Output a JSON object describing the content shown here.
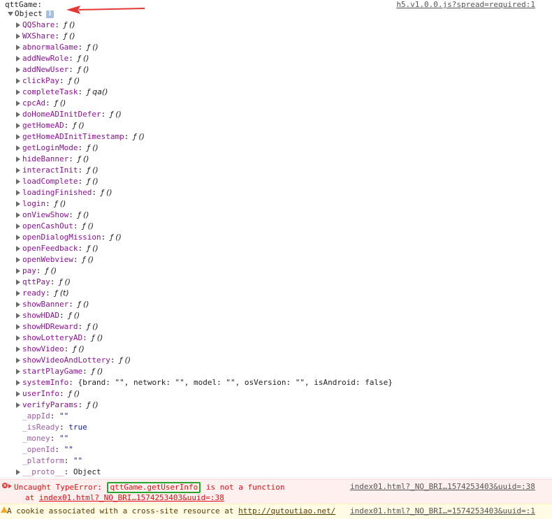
{
  "log": {
    "label": "qttGame:",
    "source": "h5.v1.0.0.js?spread=required:1",
    "object_label": "Object",
    "info_glyph": "i"
  },
  "properties": [
    {
      "name": "QQShare",
      "value": "ƒ ()",
      "expandable": true
    },
    {
      "name": "WXShare",
      "value": "ƒ ()",
      "expandable": true
    },
    {
      "name": "abnormalGame",
      "value": "ƒ ()",
      "expandable": true
    },
    {
      "name": "addNewRole",
      "value": "ƒ ()",
      "expandable": true
    },
    {
      "name": "addNewUser",
      "value": "ƒ ()",
      "expandable": true
    },
    {
      "name": "clickPay",
      "value": "ƒ ()",
      "expandable": true
    },
    {
      "name": "completeTask",
      "value": "ƒ qa()",
      "expandable": true
    },
    {
      "name": "cpcAd",
      "value": "ƒ ()",
      "expandable": true
    },
    {
      "name": "doHomeADInitDefer",
      "value": "ƒ ()",
      "expandable": true
    },
    {
      "name": "getHomeAD",
      "value": "ƒ ()",
      "expandable": true
    },
    {
      "name": "getHomeADInitTimestamp",
      "value": "ƒ ()",
      "expandable": true
    },
    {
      "name": "getLoginMode",
      "value": "ƒ ()",
      "expandable": true
    },
    {
      "name": "hideBanner",
      "value": "ƒ ()",
      "expandable": true
    },
    {
      "name": "interactInit",
      "value": "ƒ ()",
      "expandable": true
    },
    {
      "name": "loadComplete",
      "value": "ƒ ()",
      "expandable": true
    },
    {
      "name": "loadingFinished",
      "value": "ƒ ()",
      "expandable": true
    },
    {
      "name": "login",
      "value": "ƒ ()",
      "expandable": true
    },
    {
      "name": "onViewShow",
      "value": "ƒ ()",
      "expandable": true
    },
    {
      "name": "openCashOut",
      "value": "ƒ ()",
      "expandable": true
    },
    {
      "name": "openDialogMission",
      "value": "ƒ ()",
      "expandable": true
    },
    {
      "name": "openFeedback",
      "value": "ƒ ()",
      "expandable": true
    },
    {
      "name": "openWebview",
      "value": "ƒ ()",
      "expandable": true
    },
    {
      "name": "pay",
      "value": "ƒ ()",
      "expandable": true
    },
    {
      "name": "qttPay",
      "value": "ƒ ()",
      "expandable": true
    },
    {
      "name": "ready",
      "value": "ƒ (t)",
      "expandable": true
    },
    {
      "name": "showBanner",
      "value": "ƒ ()",
      "expandable": true
    },
    {
      "name": "showHDAD",
      "value": "ƒ ()",
      "expandable": true
    },
    {
      "name": "showHDReward",
      "value": "ƒ ()",
      "expandable": true
    },
    {
      "name": "showLotteryAD",
      "value": "ƒ ()",
      "expandable": true
    },
    {
      "name": "showVideo",
      "value": "ƒ ()",
      "expandable": true
    },
    {
      "name": "showVideoAndLottery",
      "value": "ƒ ()",
      "expandable": true
    },
    {
      "name": "startPlayGame",
      "value": "ƒ ()",
      "expandable": true
    },
    {
      "name": "systemInfo",
      "value": "{brand: \"\", network: \"\", model: \"\", osVersion: \"\", isAndroid: false}",
      "expandable": true
    },
    {
      "name": "userInfo",
      "value": "ƒ ()",
      "expandable": true
    },
    {
      "name": "verifyParams",
      "value": "ƒ ()",
      "expandable": true
    },
    {
      "name": "_appId",
      "value": "\"\"",
      "expandable": false
    },
    {
      "name": "_isReady",
      "value": "true",
      "expandable": false
    },
    {
      "name": "_money",
      "value": "\"\"",
      "expandable": false
    },
    {
      "name": "_openId",
      "value": "\"\"",
      "expandable": false
    },
    {
      "name": "_platform",
      "value": "\"\"",
      "expandable": false
    },
    {
      "name": "__proto__",
      "value": "Object",
      "expandable": true
    }
  ],
  "error": {
    "prefix": "Uncaught TypeError: ",
    "highlight": "qttGame.getUserInfo",
    "suffix": " is not a function",
    "at_prefix": "at ",
    "at_link": "index01.html?_NO_BRI…1574253403&uuid=:38",
    "source": "index01.html?_NO_BRI…1574253403&uuid=:38"
  },
  "warning": {
    "text": "A cookie associated with a cross-site resource at ",
    "link": "http://qutoutiao.net/",
    "source": "index01.html?_NO_BRI…=1574253403&uuid=:1"
  },
  "colors": {
    "property_name": "#881391",
    "error_text": "#e30f0f",
    "highlight_box": "#2aa42a",
    "arrow": "#e53935"
  }
}
